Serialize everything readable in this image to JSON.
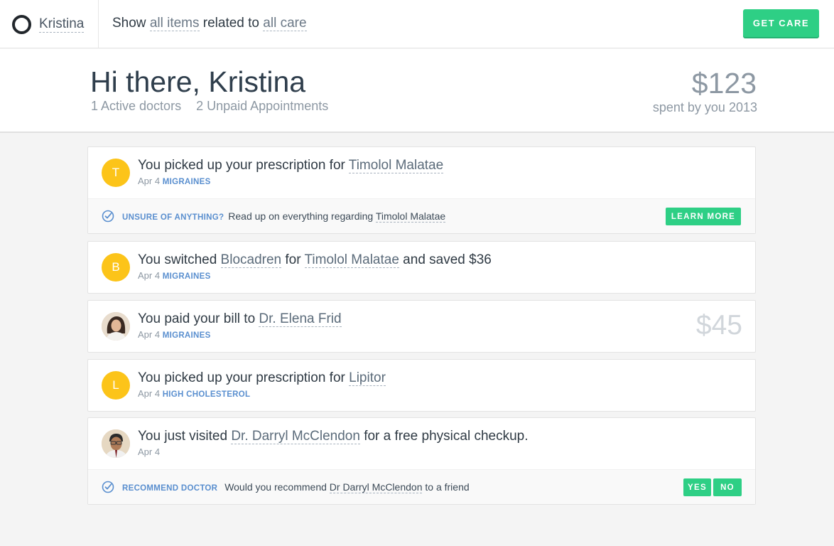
{
  "topbar": {
    "user_name": "Kristina",
    "filter_prefix": "Show ",
    "filter_items": "all items",
    "filter_middle": " related to ",
    "filter_care": "all care",
    "get_care_label": "GET CARE"
  },
  "header": {
    "greeting": "Hi there, Kristina",
    "active_doctors": "1 Active doctors",
    "unpaid_appointments": "2 Unpaid Appointments",
    "spent_amount": "$123",
    "spent_label": "spent by you 2013"
  },
  "feed": [
    {
      "avatar_letter": "T",
      "title_prefix": "You picked up your prescription for ",
      "title_link": "Timolol Malatae",
      "date": "Apr 4",
      "tag": "MIGRAINES",
      "footer": {
        "label": "UNSURE OF ANYTHING?",
        "text": "Read up on everything regarding ",
        "link": "Timolol Malatae",
        "button": "LEARN MORE"
      }
    },
    {
      "avatar_letter": "B",
      "title_prefix": "You switched ",
      "title_link": "Blocadren",
      "title_middle": " for ",
      "title_link2": "Timolol Malatae",
      "title_suffix": " and saved $36",
      "date": "Apr 4",
      "tag": "MIGRAINES"
    },
    {
      "avatar": "doctor-photo-female",
      "title_prefix": "You paid your bill to ",
      "title_link": "Dr. Elena Frid",
      "date": "Apr 4",
      "tag": "MIGRAINES",
      "amount": "$45"
    },
    {
      "avatar_letter": "L",
      "title_prefix": "You picked up your prescription for ",
      "title_link": "Lipitor",
      "date": "Apr 4",
      "tag": "HIGH CHOLESTEROL"
    },
    {
      "avatar": "doctor-photo-male",
      "title_prefix": "You just visited ",
      "title_link": "Dr. Darryl McClendon",
      "title_suffix": " for a free physical checkup.",
      "date": "Apr 4",
      "footer": {
        "label": "RECOMMEND DOCTOR",
        "text": "Would you recommend ",
        "link": "Dr Darryl McClendon",
        "text_suffix": " to a friend",
        "yes": "YES",
        "no": "NO"
      }
    }
  ],
  "colors": {
    "accent_green": "#2ecf85",
    "tag_blue": "#5a8fcf",
    "avatar_yellow": "#fcc419"
  }
}
